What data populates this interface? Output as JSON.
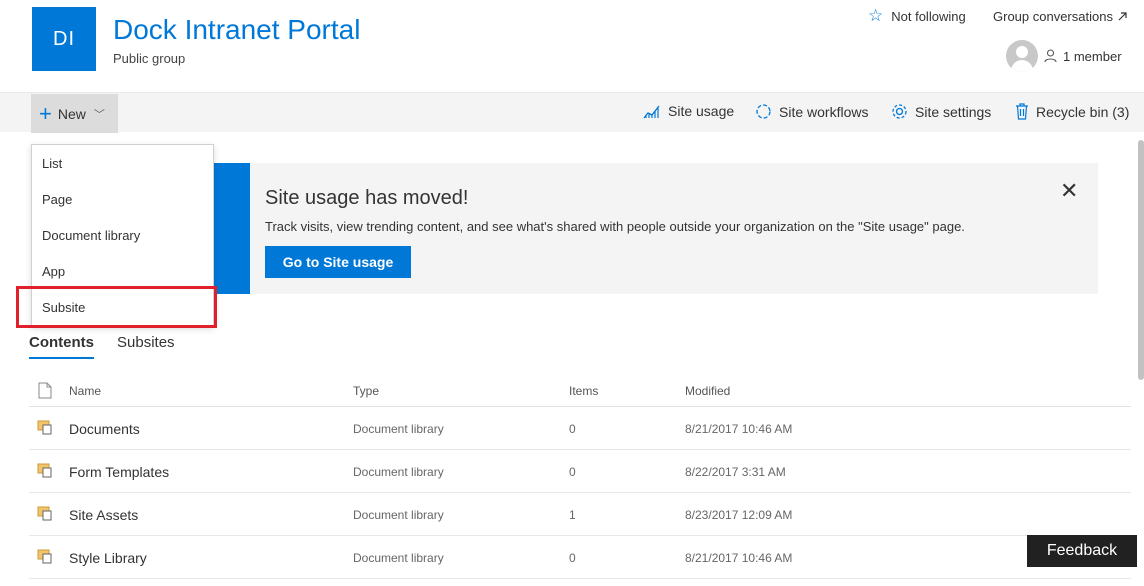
{
  "site": {
    "logo_initials": "DI",
    "title": "Dock Intranet Portal",
    "subtitle": "Public group",
    "follow_label": "Not following",
    "group_conversations": "Group conversations",
    "members": "1 member"
  },
  "commandbar": {
    "new_label": "New",
    "site_usage": "Site usage",
    "site_workflows": "Site workflows",
    "site_settings": "Site settings",
    "recycle_bin": "Recycle bin (3)"
  },
  "new_menu": {
    "items": [
      "List",
      "Page",
      "Document library",
      "App",
      "Subsite"
    ],
    "highlighted": "Subsite"
  },
  "banner": {
    "title": "Site usage has moved!",
    "text": "Track visits, view trending content, and see what's shared with people outside your organization on the \"Site usage\" page.",
    "button": "Go to Site usage"
  },
  "tabs": [
    "Contents",
    "Subsites"
  ],
  "table": {
    "headers": [
      "Name",
      "Type",
      "Items",
      "Modified"
    ],
    "rows": [
      {
        "name": "Documents",
        "type": "Document library",
        "items": "0",
        "modified": "8/21/2017 10:46 AM"
      },
      {
        "name": "Form Templates",
        "type": "Document library",
        "items": "0",
        "modified": "8/22/2017 3:31 AM"
      },
      {
        "name": "Site Assets",
        "type": "Document library",
        "items": "1",
        "modified": "8/23/2017 12:09 AM"
      },
      {
        "name": "Style Library",
        "type": "Document library",
        "items": "0",
        "modified": "8/21/2017 10:46 AM"
      }
    ]
  },
  "feedback": "Feedback",
  "colors": {
    "accent": "#0078d7",
    "highlight_border": "#e0202a"
  }
}
